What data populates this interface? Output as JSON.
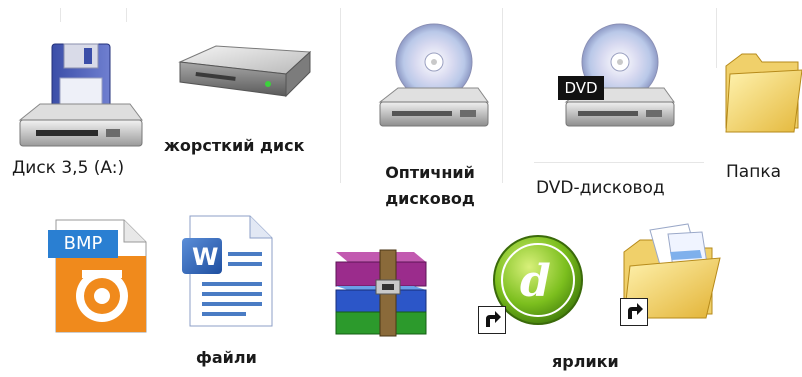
{
  "top_row": {
    "floppy": {
      "label": "Диск 3,5 (A:)",
      "icon": "floppy-drive-icon"
    },
    "hdd": {
      "label": "жорсткий диск",
      "icon": "hard-disk-icon"
    },
    "optical": {
      "label_line1": "Оптичний",
      "label_line2": "дисковод",
      "icon": "optical-drive-icon"
    },
    "dvd": {
      "label": "DVD-дисковод",
      "badge": "DVD",
      "icon": "dvd-drive-icon"
    },
    "folder": {
      "label": "Папка",
      "icon": "folder-icon"
    }
  },
  "bottom_row": {
    "bmp": {
      "badge": "BMP",
      "icon": "bmp-file-icon"
    },
    "word": {
      "icon": "word-document-icon"
    },
    "rar": {
      "icon": "winrar-archive-icon"
    },
    "dreamweaver_shortcut": {
      "icon": "dreamweaver-shortcut-icon"
    },
    "folder_shortcut": {
      "icon": "folder-shortcut-icon"
    },
    "files_label": "файли",
    "shortcuts_label": "ярлики"
  }
}
